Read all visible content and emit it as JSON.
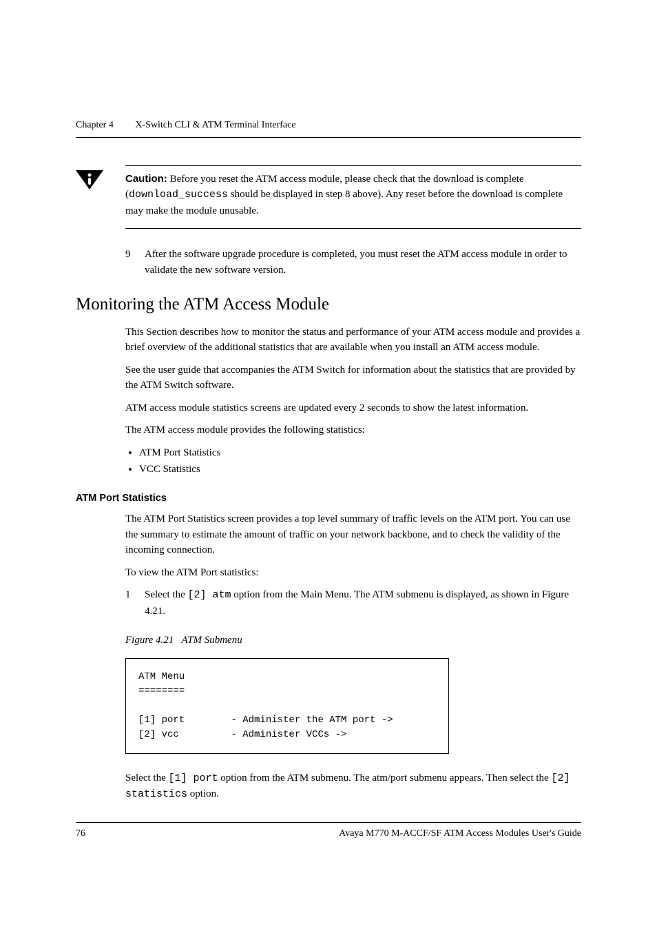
{
  "header": {
    "chapter": "Chapter 4",
    "title": "X-Switch CLI & ATM Terminal Interface"
  },
  "caution": {
    "label": "Caution:",
    "before": " Before you reset the ATM access module, please check that the download is complete (",
    "mono": "download_success",
    "after": " should be displayed in step 8 above). Any reset before the download is complete may make the module unusable."
  },
  "step9": {
    "num": "9",
    "text": "After the software upgrade procedure is completed, you must reset the ATM access module in order to validate the new software version."
  },
  "section": {
    "title": "Monitoring the ATM Access Module",
    "p1": "This Section describes how to monitor the status and performance of your ATM access module and provides a brief overview of the additional statistics that are available when you install an ATM access module.",
    "p2": "See the user guide that accompanies the ATM Switch for information about the statistics that are provided by the ATM Switch software.",
    "p3": "ATM access module statistics screens are updated every 2 seconds to show the latest information.",
    "p4": "The ATM access module provides the following statistics:",
    "bullets": [
      "ATM Port Statistics",
      "VCC Statistics"
    ]
  },
  "subsection": {
    "title": "ATM Port Statistics",
    "p1": "The ATM Port Statistics screen provides a top level summary of traffic levels on the ATM port. You can use the summary to estimate the amount of traffic on your network backbone, and to check the validity of the incoming connection.",
    "p2": "To view the ATM Port statistics:",
    "step1_num": "1",
    "step1_before": "Select the ",
    "step1_mono": "[2] atm",
    "step1_after": " option from the Main Menu. The ATM submenu is displayed, as shown in Figure 4.21."
  },
  "figure": {
    "caption_num": "Figure 4.21",
    "caption_title": "ATM Submenu",
    "code": "ATM Menu\n========\n\n[1] port        - Administer the ATM port ->\n[2] vcc         - Administer VCCs ->\n"
  },
  "afterfig": {
    "before1": "Select the ",
    "mono1": "[1] port",
    "mid": " option from the ATM submenu. The atm/port submenu appears. Then select the ",
    "mono2": "[2] statistics",
    "after": " option."
  },
  "footer": {
    "page": "76",
    "text": "Avaya M770 M-ACCF/SF ATM Access Modules User's Guide"
  }
}
